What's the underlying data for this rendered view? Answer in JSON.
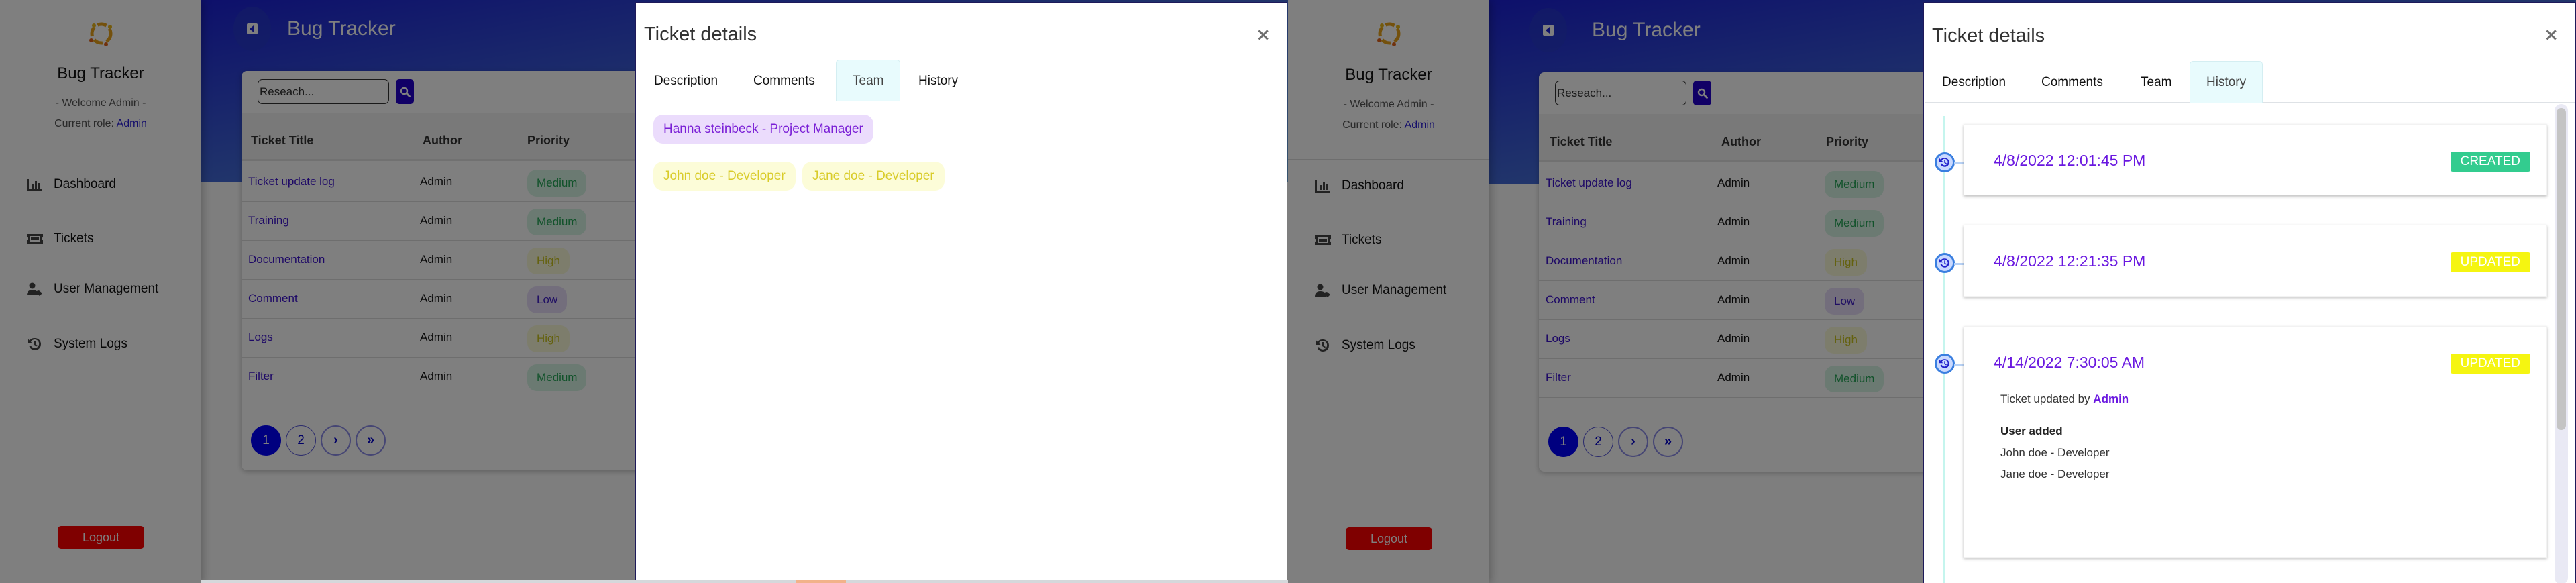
{
  "app": {
    "brand": "Bug Tracker",
    "welcome": "- Welcome Admin -",
    "role_label": "Current role: ",
    "role_value": "Admin",
    "logo_icon": "team-circle-logo-icon",
    "nav": [
      {
        "label": "Dashboard",
        "icon": "bar-chart-icon"
      },
      {
        "label": "Tickets",
        "icon": "ticket-icon"
      },
      {
        "label": "User Management",
        "icon": "user-tag-icon"
      },
      {
        "label": "System Logs",
        "icon": "history-icon"
      }
    ],
    "logout_label": "Logout",
    "header_title": "Bug Tracker",
    "search_placeholder": "Reseach...",
    "table": {
      "headers": [
        "Ticket Title",
        "Author",
        "Priority"
      ],
      "rows": [
        {
          "title": "Ticket update log",
          "author": "Admin",
          "priority": "Medium"
        },
        {
          "title": "Training",
          "author": "Admin",
          "priority": "Medium"
        },
        {
          "title": "Documentation",
          "author": "Admin",
          "priority": "High"
        },
        {
          "title": "Comment",
          "author": "Admin",
          "priority": "Low"
        },
        {
          "title": "Logs",
          "author": "Admin",
          "priority": "High"
        },
        {
          "title": "Filter",
          "author": "Admin",
          "priority": "Medium"
        }
      ]
    },
    "pagination": {
      "pages": [
        "1",
        "2"
      ],
      "current": "1",
      "next": "›",
      "last": "»"
    }
  },
  "priority_colors": {
    "Medium": {
      "bg": "#d6f5e4",
      "fg": "#22a455"
    },
    "High": {
      "bg": "#fbfbd8",
      "fg": "#c9c21c"
    },
    "Low": {
      "bg": "#e7dcf8",
      "fg": "#3f1cc7"
    }
  },
  "modal": {
    "title": "Ticket details",
    "close": "×",
    "tabs": [
      "Description",
      "Comments",
      "Team",
      "History"
    ]
  },
  "team_view": {
    "active_tab": "Team",
    "project_manager": "Hanna steinbeck - Project Manager",
    "developers": [
      "John doe - Developer",
      "Jane doe - Developer"
    ]
  },
  "history_view": {
    "active_tab": "History",
    "events": [
      {
        "date": "4/8/2022 12:01:45 PM",
        "type": "CREATED",
        "color": "#33cc8f"
      },
      {
        "date": "4/8/2022 12:21:35 PM",
        "type": "UPDATED",
        "color": "#f5f511"
      },
      {
        "date": "4/14/2022 7:30:05 AM",
        "type": "UPDATED",
        "color": "#f5f511",
        "updated_by_label": "Ticket updated by ",
        "updated_by": "Admin",
        "change_heading": "User added",
        "changes": [
          "John doe - Developer",
          "Jane doe - Developer"
        ]
      }
    ]
  }
}
